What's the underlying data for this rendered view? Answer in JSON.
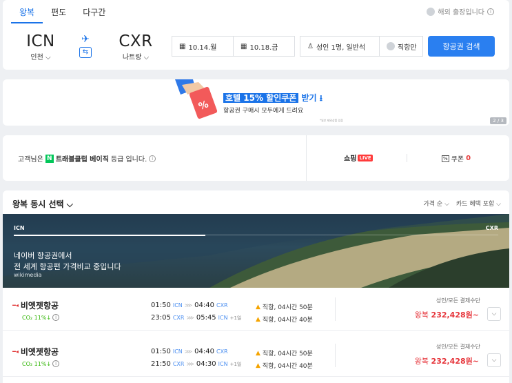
{
  "tabs": [
    "왕복",
    "편도",
    "다구간"
  ],
  "overseas_label": "해외 출장입니다",
  "origin": {
    "code": "ICN",
    "city": "인천 ⌵"
  },
  "destination": {
    "code": "CXR",
    "city": "나트랑 ⌵"
  },
  "depart_date": "10.14.월",
  "return_date": "10.18.금",
  "passengers": "성인 1명, 일반석",
  "direct_only": "직항만",
  "search_button": "항공권 검색",
  "banner": {
    "highlight": "호텔 15% 할인쿠폰",
    "highlight_rest": "받기 ⭳",
    "subtitle": "항공권 구매시 모두에게 드려요",
    "fineprint": "*일부 제외상품 있음",
    "pager": "2 / 3"
  },
  "member": {
    "prefix": "고객님은",
    "badge": "N",
    "grade": "트래블클럽 베이직",
    "suffix": "등급 입니다.",
    "shopping": "쇼핑",
    "live": "LIVE",
    "coupon_icon": "%",
    "coupon_label": "쿠폰",
    "coupon_count": "0"
  },
  "results": {
    "heading": "왕복 동시 선택 ⌵",
    "sort": "가격 순 ⌵",
    "card_filter": "카드 혜택 포함 ⌵",
    "hero": {
      "from": "ICN",
      "to": "CXR",
      "line1": "네이버 항공권에서",
      "line2": "전 세계 항공편 가격비교 중입니다",
      "credit": "wikimedia"
    },
    "flights": [
      {
        "airline": "비엣젯항공",
        "co2": "CO₂ 11%↓",
        "out": {
          "dep": "01:50",
          "dep_ap": "ICN",
          "arr": "04:40",
          "arr_ap": "CXR",
          "plus": ""
        },
        "ret": {
          "dep": "23:05",
          "dep_ap": "CXR",
          "arr": "05:45",
          "arr_ap": "ICN",
          "plus": "+1일"
        },
        "out_dur": "직항, 04시간 50분",
        "ret_dur": "직항, 04시간 40분",
        "fare_label": "성인/모든 결제수단",
        "price_prefix": "왕복",
        "price": "232,428원~"
      },
      {
        "airline": "비엣젯항공",
        "co2": "CO₂ 11%↓",
        "out": {
          "dep": "01:50",
          "dep_ap": "ICN",
          "arr": "04:40",
          "arr_ap": "CXR",
          "plus": ""
        },
        "ret": {
          "dep": "21:50",
          "dep_ap": "CXR",
          "arr": "04:30",
          "arr_ap": "ICN",
          "plus": "+1일"
        },
        "out_dur": "직항, 04시간 50분",
        "ret_dur": "직항, 04시간 40분",
        "fare_label": "성인/모든 결제수단",
        "price_prefix": "왕복",
        "price": "232,428원~"
      }
    ]
  }
}
